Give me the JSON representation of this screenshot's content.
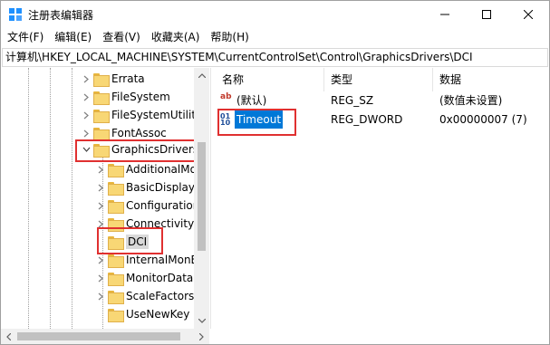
{
  "window": {
    "title": "注册表编辑器",
    "buttons": {
      "minimize": "—",
      "maximize": "☐",
      "close": "✕"
    }
  },
  "menu": [
    "文件(F)",
    "编辑(E)",
    "查看(V)",
    "收藏夹(A)",
    "帮助(H)"
  ],
  "address": "计算机\\HKEY_LOCAL_MACHINE\\SYSTEM\\CurrentControlSet\\Control\\GraphicsDrivers\\DCI",
  "tree": {
    "items": [
      {
        "label": "Errata"
      },
      {
        "label": "FileSystem"
      },
      {
        "label": "FileSystemUtiliti"
      },
      {
        "label": "FontAssoc"
      },
      {
        "label": "GraphicsDrivers"
      },
      {
        "label": "AdditionalMo"
      },
      {
        "label": "BasicDisplay"
      },
      {
        "label": "Configuration"
      },
      {
        "label": "Connectivity"
      },
      {
        "label": "DCI"
      },
      {
        "label": "InternalMonE"
      },
      {
        "label": "MonitorData"
      },
      {
        "label": "ScaleFactors"
      },
      {
        "label": "UseNewKey"
      }
    ]
  },
  "list": {
    "headers": {
      "name": "名称",
      "type": "类型",
      "data": "数据"
    },
    "rows": [
      {
        "name": "(默认)",
        "type": "REG_SZ",
        "data": "(数值未设置)",
        "icon": "ab"
      },
      {
        "name": "Timeout",
        "type": "REG_DWORD",
        "data": "0x00000007 (7)",
        "icon": "010"
      }
    ]
  },
  "colors": {
    "highlight": "#e03030",
    "selection": "#0078d7",
    "folder": "#f8d775"
  }
}
